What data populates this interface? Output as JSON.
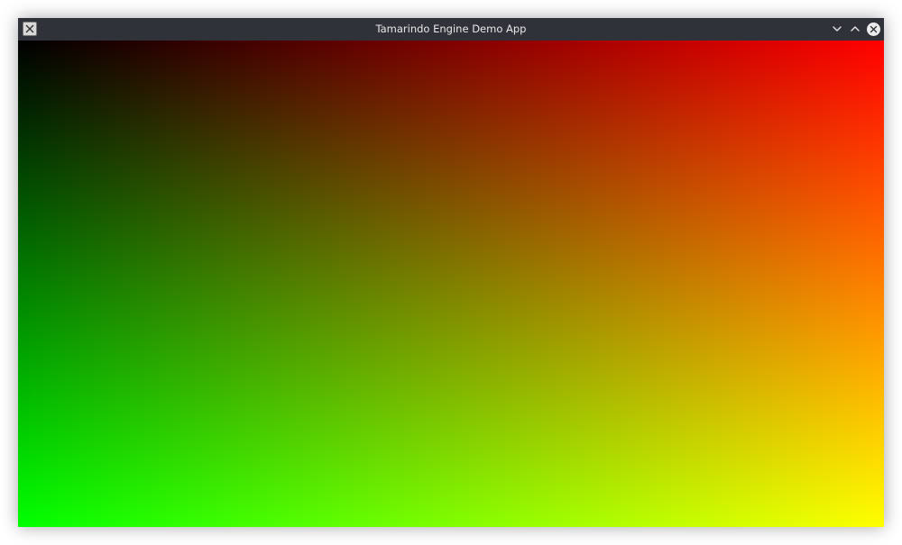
{
  "window": {
    "title": "Tamarindo Engine Demo App",
    "icons": {
      "app": "x11-icon",
      "minimize": "chevron-down-icon",
      "maximize": "chevron-up-icon",
      "close": "close-icon"
    }
  },
  "viewport": {
    "description_colors": {
      "top_left": "#000000",
      "top_right": "#ff0000",
      "bottom_left": "#00ff00",
      "bottom_right": "#ffff00"
    }
  }
}
